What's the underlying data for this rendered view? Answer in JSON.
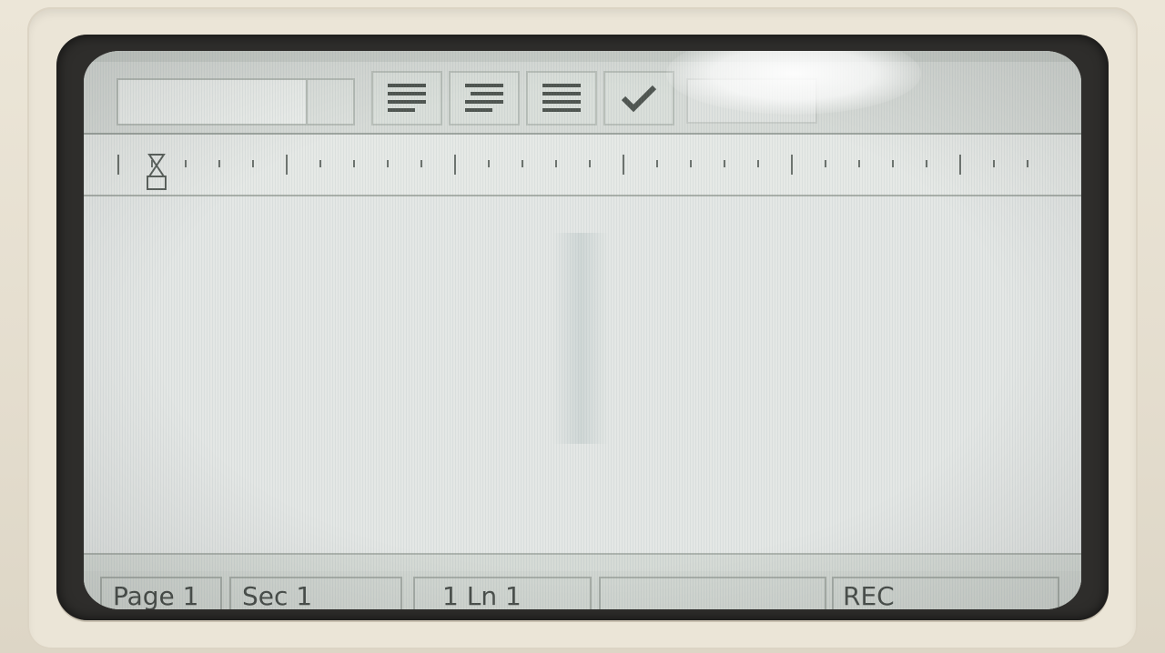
{
  "toolbar": {
    "style_value": "",
    "buttons": [
      {
        "icon": "align-left-icon"
      },
      {
        "icon": "align-center-icon"
      },
      {
        "icon": "justify-icon"
      },
      {
        "icon": "check-icon"
      }
    ]
  },
  "status": {
    "page": "Page 1",
    "sec": "Sec 1",
    "position": "1 Ln 1",
    "rec": "REC"
  },
  "colors": {
    "screen": "#dfe3e0",
    "bezel": "#2e2d2b",
    "casing": "#e7e1d3",
    "ink": "#4a4f4b"
  }
}
